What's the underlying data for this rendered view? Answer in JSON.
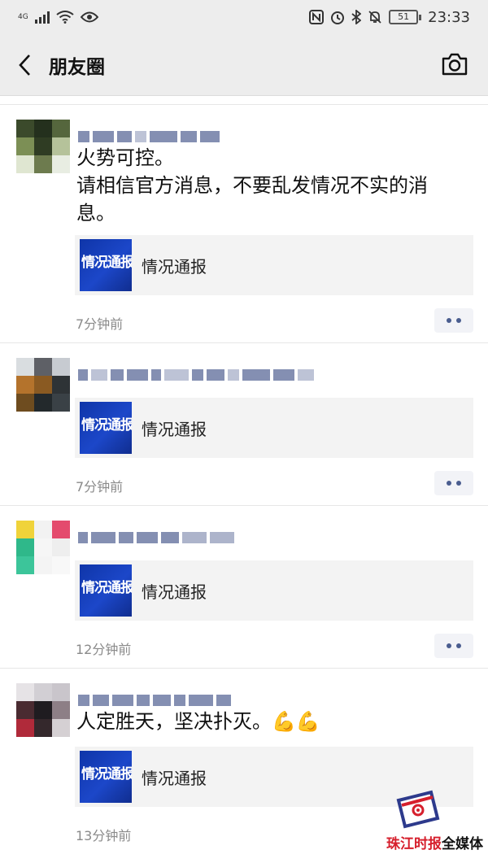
{
  "status_bar": {
    "network_label": "4G",
    "time": "23:33",
    "battery": "51",
    "icons": [
      "signal-icon",
      "wifi-icon",
      "eye-icon",
      "nfc-icon",
      "alarm-icon",
      "bluetooth-icon",
      "mute-icon",
      "battery-icon"
    ]
  },
  "navbar": {
    "title": "朋友圈",
    "back_icon": "chevron-left-icon",
    "camera_icon": "camera-icon"
  },
  "posts": [
    {
      "text": "火势可控。\n请相信官方消息，不要乱发情况不实的消息。",
      "card_thumb_text": "情况通报",
      "card_title": "情况通报",
      "time": "7分钟前"
    },
    {
      "text": "",
      "card_thumb_text": "情况通报",
      "card_title": "情况通报",
      "time": "7分钟前"
    },
    {
      "text": "",
      "card_thumb_text": "情况通报",
      "card_title": "情况通报",
      "time": "12分钟前"
    },
    {
      "text": "人定胜天，坚决扑灭。💪💪",
      "card_thumb_text": "情况通报",
      "card_title": "情况通报",
      "time": "13分钟前"
    }
  ],
  "watermark": {
    "red_text": "珠江时报",
    "black_text": "全媒体"
  },
  "colors": {
    "background": "#ffffff",
    "bar_background": "#ededed",
    "card_background": "#f3f3f3",
    "link_blue": "#4a5d8f",
    "thumb_blue": "#1c47c9",
    "watermark_red": "#d61f2c"
  }
}
